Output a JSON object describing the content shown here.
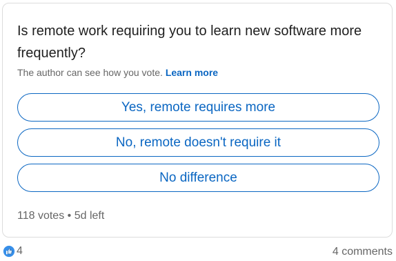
{
  "poll": {
    "question": "Is remote work requiring you to learn new software more frequently?",
    "disclosure": {
      "text": "The author can see how you vote.",
      "link_label": "Learn more"
    },
    "options": [
      "Yes, remote requires more",
      "No, remote doesn't require it",
      "No difference"
    ],
    "meta": {
      "votes": "118 votes",
      "separator": "•",
      "time_left": "5d left"
    }
  },
  "social": {
    "reaction_icon": "like-icon",
    "reaction_count": "4",
    "comments": "4 comments"
  },
  "colors": {
    "accent": "#0a66c2",
    "muted_text": "#666666",
    "border": "#dcdcdc"
  }
}
